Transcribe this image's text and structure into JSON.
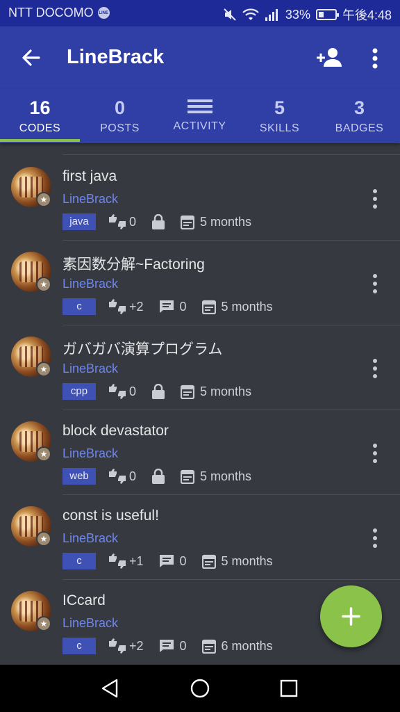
{
  "status_bar": {
    "carrier": "NTT DOCOMO",
    "line_badge": "LINE",
    "battery": "33%",
    "battery_level": 0.33,
    "time": "午後4:48"
  },
  "app_bar": {
    "title": "LineBrack",
    "back_icon": "arrow-left-icon",
    "add_icon": "person-add-icon",
    "more_icon": "more-vert-icon"
  },
  "tabs": [
    {
      "count": "16",
      "label": "CODES",
      "active": true
    },
    {
      "count": "0",
      "label": "POSTS",
      "active": false
    },
    {
      "count": "",
      "label": "ACTIVITY",
      "active": false,
      "icon": "menu-icon"
    },
    {
      "count": "5",
      "label": "SKILLS",
      "active": false
    },
    {
      "count": "3",
      "label": "BADGES",
      "active": false
    }
  ],
  "codes": [
    {
      "title": "first java",
      "author": "LineBrack",
      "language": "java",
      "votes": "0",
      "private": true,
      "comments": null,
      "date": "5 months"
    },
    {
      "title": "素因数分解~Factoring",
      "author": "LineBrack",
      "language": "c",
      "votes": "+2",
      "private": false,
      "comments": "0",
      "date": "5 months"
    },
    {
      "title": "ガバガバ演算プログラム",
      "author": "LineBrack",
      "language": "cpp",
      "votes": "0",
      "private": true,
      "comments": null,
      "date": "5 months"
    },
    {
      "title": "block devastator",
      "author": "LineBrack",
      "language": "web",
      "votes": "0",
      "private": true,
      "comments": null,
      "date": "5 months"
    },
    {
      "title": "const is useful!",
      "author": "LineBrack",
      "language": "c",
      "votes": "+1",
      "private": false,
      "comments": "0",
      "date": "5 months"
    },
    {
      "title": "ICcard",
      "author": "LineBrack",
      "language": "c",
      "votes": "+2",
      "private": false,
      "comments": "0",
      "date": "6 months"
    }
  ],
  "fab": {
    "icon": "plus-icon"
  },
  "nav_bar": {
    "back": "triangle-back-icon",
    "home": "circle-home-icon",
    "recents": "square-recents-icon"
  },
  "colors": {
    "status_bar": "#1f2a99",
    "app_bar": "#303fa5",
    "background": "#363a40",
    "accent": "#8bc34a",
    "author_link": "#6f86ef",
    "language_tag": "#3f51b5"
  }
}
